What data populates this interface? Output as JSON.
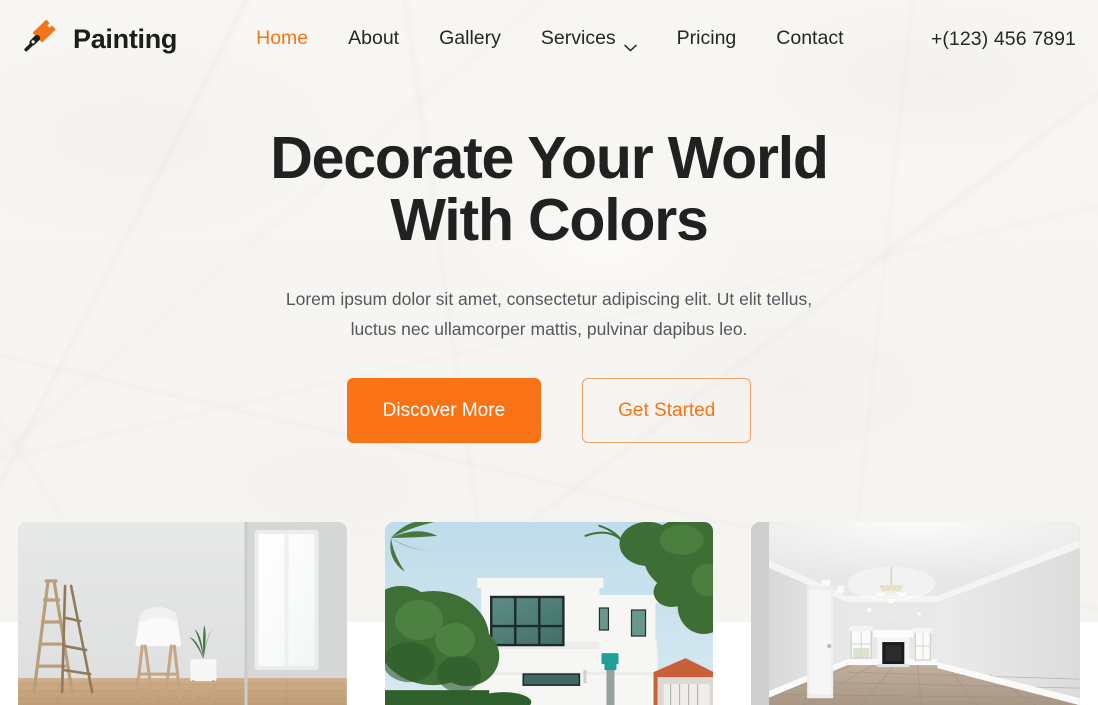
{
  "theme": {
    "accent": "#f97316",
    "accent_border": "#eda263",
    "text_dark": "#212121",
    "text_body": "#53585e",
    "bg_cream": "#f7f5f1",
    "bg_white": "#ffffff"
  },
  "header": {
    "brand": {
      "name": "Painting",
      "icon": "paintbrush-icon"
    },
    "nav": [
      {
        "label": "Home",
        "active": true,
        "icon": null
      },
      {
        "label": "About",
        "active": false,
        "icon": null
      },
      {
        "label": "Gallery",
        "active": false,
        "icon": null
      },
      {
        "label": "Services",
        "active": false,
        "icon": "chevron-down-icon"
      },
      {
        "label": "Pricing",
        "active": false,
        "icon": null
      },
      {
        "label": "Contact",
        "active": false,
        "icon": null
      }
    ],
    "phone": "+(123) 456 7891"
  },
  "hero": {
    "title_line_1": "Decorate Your World",
    "title_line_2": "With Colors",
    "subtitle_line_1": "Lorem ipsum dolor sit amet, consectetur adipiscing elit. Ut elit tellus,",
    "subtitle_line_2": "luctus nec ullamcorper mattis, pulvinar dapibus leo.",
    "primary_button": "Discover More",
    "secondary_button": "Get Started"
  },
  "gallery": {
    "cards": [
      {
        "name": "empty-room-with-ladder",
        "alt": "White empty room with wooden step ladder, white stool and potted plant beside a bright window"
      },
      {
        "name": "modern-white-house",
        "alt": "Modern white two-storey house exterior with large glass windows surrounded by green trees under a blue sky"
      },
      {
        "name": "empty-living-room",
        "alt": "Empty white living room with chandelier, fireplace and light wood flooring"
      }
    ]
  }
}
